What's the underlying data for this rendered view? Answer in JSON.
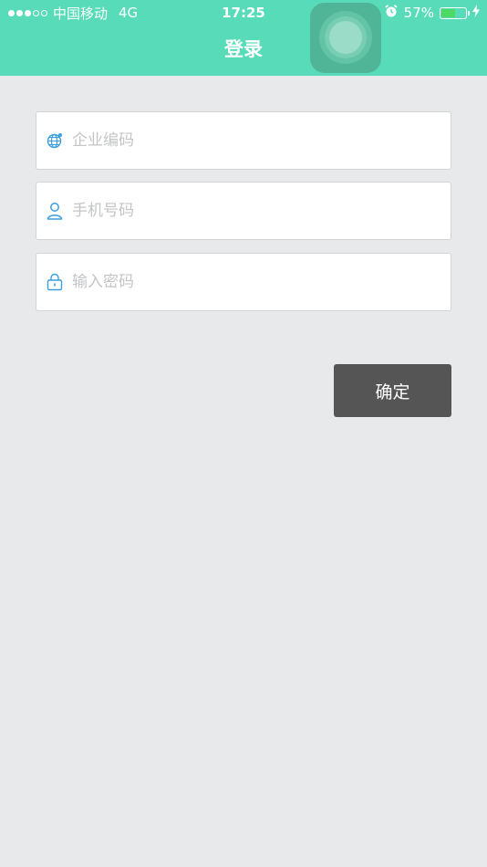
{
  "status_bar": {
    "signal_filled": 3,
    "signal_total": 5,
    "carrier": "中国移动",
    "network": "4G",
    "time": "17:25",
    "battery_percent_label": "57%",
    "battery_level": 0.57,
    "icons": [
      "orientation-lock-icon",
      "alarm-icon",
      "charging-bolt-icon"
    ]
  },
  "nav": {
    "title": "登录"
  },
  "form": {
    "company_code": {
      "value": "",
      "placeholder": "企业编码",
      "icon": "globe-icon"
    },
    "phone": {
      "value": "",
      "placeholder": "手机号码",
      "icon": "user-icon"
    },
    "password": {
      "value": "",
      "placeholder": "输入密码",
      "icon": "lock-icon"
    },
    "confirm_label": "确定"
  },
  "colors": {
    "header": "#58dbb8",
    "background": "#e8e9eb",
    "icon_blue": "#3a9ee0",
    "button": "#555555",
    "battery_fill": "#4cd964"
  }
}
